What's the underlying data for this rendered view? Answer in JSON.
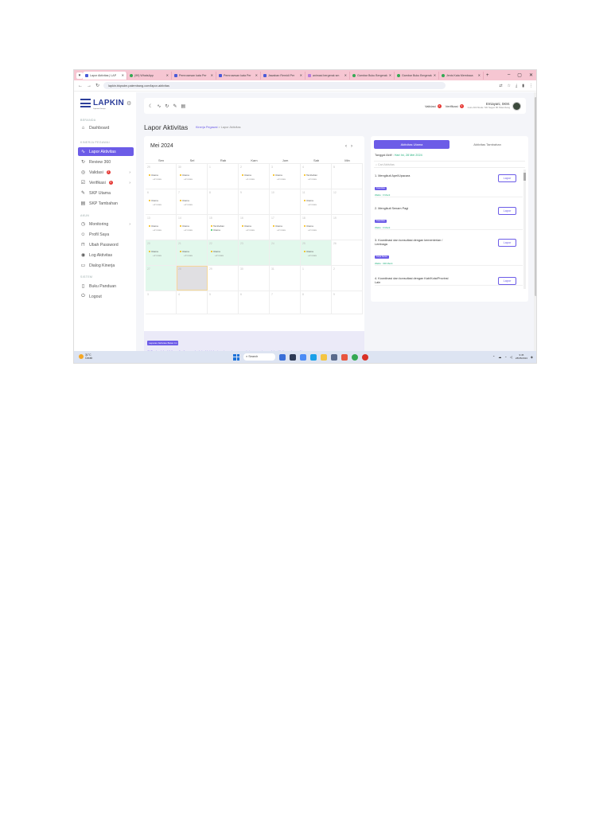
{
  "browser": {
    "tabs": [
      {
        "label": "Lapor Aktivitas | LAP",
        "active": true
      },
      {
        "label": "(99) WhatsApp"
      },
      {
        "label": "Pemrosesan kata Per"
      },
      {
        "label": "Pemrosesan kata Per"
      },
      {
        "label": "Jawaban Remidi Per"
      },
      {
        "label": "animasi bergerak sm"
      },
      {
        "label": "Gambar Buku Bergerak"
      },
      {
        "label": "Gambar Buku Bergerak"
      },
      {
        "label": "Jenis Kata Membaca"
      }
    ],
    "url": "lapkin.bkpsdm.palembang.com/lapor-aktivitas"
  },
  "sidebar": {
    "logo": "LAPKIN",
    "logo_sub": "Laporan Kinerja",
    "sections": {
      "beranda": "BERANDA",
      "kinerja": "KINERJA PEGAWAI",
      "akun": "AKUN",
      "sistem": "SISTEM"
    },
    "items": {
      "dashboard": "Dashboard",
      "lapor": "Lapor Aktivitas",
      "review": "Review 360",
      "validasi": "Validasi",
      "validasi_badge": "3",
      "verifikasi": "Verifikasi",
      "verifikasi_badge": "3",
      "skp_utama": "SKP Utama",
      "skp_tambahan": "SKP Tambahan",
      "monitoring": "Monitoring",
      "profil": "Profil Saya",
      "password": "Ubah Password",
      "log": "Log Aktivitas",
      "dialog": "Dialog Kinerja",
      "panduan": "Buku Panduan",
      "logout": "Logout"
    }
  },
  "header": {
    "validasi": "Validasi",
    "verifikasi": "Verifikasi",
    "validasi_count": "2",
    "verifikasi_count": "3",
    "user_name": "Erniayani, SKM.",
    "user_sub": "Guru Ahli Muda / SD Negeri 80 Palembang"
  },
  "page": {
    "title": "Lapor Aktivitas",
    "crumb_1": "Kinerja Pegawai",
    "crumb_sep": ">",
    "crumb_2": "Lapor Aktivitas"
  },
  "calendar": {
    "month": "Mei 2024",
    "prev": "‹",
    "next": "›",
    "days": [
      "Sen",
      "Sel",
      "Rab",
      "Kam",
      "Jum",
      "Sab",
      "Min"
    ],
    "weeks": [
      [
        {
          "n": "29",
          "ev": "Utama",
          "more": "+2 more"
        },
        {
          "n": "30",
          "ev": "Utama",
          "more": "+2 more"
        },
        {
          "n": "1"
        },
        {
          "n": "2",
          "ev": "Utama",
          "more": "+1 more"
        },
        {
          "n": "3",
          "ev": "Utama",
          "more": "+2 more"
        },
        {
          "n": "4",
          "ev": "Tambahan",
          "more": "+2 more"
        },
        {
          "n": "5"
        }
      ],
      [
        {
          "n": "6",
          "ev": "Utama",
          "more": "+2 more"
        },
        {
          "n": "7",
          "ev": "Utama",
          "more": "+2 more"
        },
        {
          "n": "8"
        },
        {
          "n": "9"
        },
        {
          "n": "10"
        },
        {
          "n": "11",
          "ev": "Utama",
          "more": "+2 more"
        },
        {
          "n": "12"
        }
      ],
      [
        {
          "n": "13",
          "ev": "Utama",
          "more": "+2 more"
        },
        {
          "n": "14",
          "ev": "Utama",
          "more": "+2 more"
        },
        {
          "n": "15",
          "ev": "Tambahan",
          "ev2": "Utama"
        },
        {
          "n": "16",
          "ev": "Utama",
          "more": "+2 more"
        },
        {
          "n": "17",
          "ev": "Utama",
          "more": "+2 more"
        },
        {
          "n": "18",
          "ev": "Utama",
          "more": "+2 more"
        },
        {
          "n": "19"
        }
      ],
      [
        {
          "n": "20",
          "ev": "Utama",
          "more": "+2 more",
          "hl": true
        },
        {
          "n": "21",
          "ev": "Utama",
          "more": "+3 more",
          "hl": true
        },
        {
          "n": "22",
          "ev": "Utama",
          "more": "+2 more",
          "hl": true
        },
        {
          "n": "23",
          "hl": true
        },
        {
          "n": "24",
          "hl": true
        },
        {
          "n": "25",
          "ev": "Utama",
          "more": "+2 more",
          "hl": true
        },
        {
          "n": "26"
        }
      ],
      [
        {
          "n": "27",
          "hl": true
        },
        {
          "n": "28",
          "today": true
        },
        {
          "n": "29"
        },
        {
          "n": "30"
        },
        {
          "n": "31"
        },
        {
          "n": "1"
        },
        {
          "n": "2"
        }
      ],
      [
        {
          "n": "3"
        },
        {
          "n": "4"
        },
        {
          "n": "5"
        },
        {
          "n": "6"
        },
        {
          "n": "7"
        },
        {
          "n": "8"
        },
        {
          "n": "9"
        }
      ]
    ],
    "alert_title": "Laporan Aktivitas Bulan Ini",
    "alert_msg": "ⓘ Berdayalah aktivitas pribadi secara berkala. Untuk berjaga-jaga, dan agar anda juga menyimpan data aktivitas anda sendiri"
  },
  "panel": {
    "tab_utama": "Aktivitas Utama",
    "tab_tambahan": "Aktivitas Tambahan",
    "tanggal_label": "Tanggal Aktif :",
    "tanggal_value": "Hari Ini, 28 Mei 2024",
    "search_placeholder": "Cari Aktivitas",
    "activities": [
      {
        "title": "1. Mengikuti Apel/Upacara",
        "tag": "Kuantitas",
        "time": "Waktu : 0 Menit",
        "btn": "Lapor"
      },
      {
        "title": "2. Mengikuti Senam Pagi",
        "tag": "Kuantitas",
        "time": "Waktu : 0 Menit",
        "btn": "Lapor"
      },
      {
        "title": "3. Koordinasi dan konsultasi dengan kementerian / Lembaga",
        "tag": "Kerja Sama",
        "time": "Waktu : 300 Menit",
        "btn": "Lapor"
      },
      {
        "title": "4. Koordinasi dan konsultasi dengan Kab/Kota/Provinsi Lain",
        "tag": "",
        "time": "",
        "btn": "Lapor"
      }
    ]
  },
  "taskbar": {
    "weather_temp": "31°C",
    "weather_desc": "Cerah",
    "search": "Search",
    "time": "9:45",
    "date": "28/05/2024"
  },
  "colors": {
    "accent": "#6c5ce7",
    "highlight": "#e2f8ec",
    "tab_strip": "#f6c6d2"
  }
}
